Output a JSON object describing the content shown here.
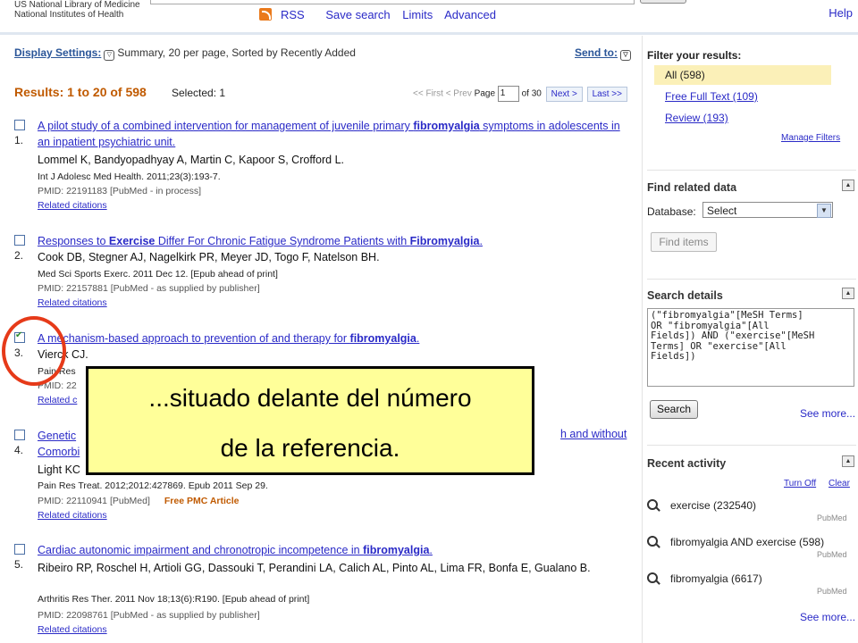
{
  "header": {
    "nlm_line1": "US National Library of Medicine",
    "nlm_line2": "National Institutes of Health",
    "toolbar": [
      "RSS",
      "Save search",
      "Limits",
      "Advanced"
    ],
    "help": "Help"
  },
  "display_settings": {
    "label": "Display Settings:",
    "value": "Summary, 20 per page, Sorted by Recently Added"
  },
  "send_to": "Send to:",
  "results": {
    "label": "Results: 1 to 20 of 598",
    "selected": "Selected: 1",
    "first": "<< First",
    "prev": "< Prev",
    "page_label": "Page",
    "page_value": "1",
    "of_pages": "of 30",
    "next": "Next >",
    "last": "Last >>"
  },
  "items": [
    {
      "num": "1.",
      "checked": false,
      "title_html": "A pilot study of a combined intervention for management of juvenile primary <b>fibromyalgia</b> symptoms in adolescents in an inpatient psychiatric unit.",
      "authors": "Lommel K, Bandyopadhyay A, Martin C, Kapoor S, Crofford L.",
      "journal": "Int J Adolesc Med Health. 2011;23(3):193-7.",
      "pmid": "PMID: 22191183 [PubMed - in process]",
      "related": "Related citations"
    },
    {
      "num": "2.",
      "checked": false,
      "title_html": "Responses to <b>Exercise</b> Differ For Chronic Fatigue Syndrome Patients with <b>Fibromyalgia</b>.",
      "authors": "Cook DB, Stegner AJ, Nagelkirk PR, Meyer JD, Togo F, Natelson BH.",
      "journal": "Med Sci Sports Exerc. 2011 Dec 12. [Epub ahead of print]",
      "pmid": "PMID: 22157881 [PubMed - as supplied by publisher]",
      "related": "Related citations"
    },
    {
      "num": "3.",
      "checked": true,
      "title_html": "A mechanism-based approach to prevention of and therapy for <b>fibromyalgia</b>.",
      "authors": "Vierck CJ.",
      "journal": "Pain Res",
      "pmid": "PMID: 22",
      "related": "Related c"
    },
    {
      "num": "4.",
      "checked": false,
      "title_html": "Genetic",
      "title2": "h and without",
      "title_line2": "Comorbi",
      "authors": "Light KC",
      "journal": "Pain Res Treat. 2012;2012:427869. Epub 2011 Sep 29.",
      "pmid": "PMID: 22110941 [PubMed]",
      "pmc": "Free PMC Article",
      "related": "Related citations"
    },
    {
      "num": "5.",
      "checked": false,
      "title_html": "Cardiac autonomic impairment and chronotropic incompetence in <b>fibromyalgia</b>.",
      "authors": "Ribeiro RP, Roschel H, Artioli GG, Dassouki T, Perandini LA, Calich AL, Pinto AL, Lima FR, Bonfa E, Gualano B.",
      "journal": "Arthritis Res Ther. 2011 Nov 18;13(6):R190. [Epub ahead of print]",
      "pmid": "PMID: 22098761 [PubMed - as supplied by publisher]",
      "related": "Related citations"
    }
  ],
  "sidebar": {
    "filter_heading": "Filter your results:",
    "filters": [
      "All (598)",
      "Free Full Text (109)",
      "Review (193)"
    ],
    "manage_filters": "Manage Filters",
    "find_related_heading": "Find related data",
    "database_label": "Database:",
    "database_value": "Select",
    "find_items": "Find items",
    "search_details_heading": "Search details",
    "search_details_text": "(\"fibromyalgia\"[MeSH Terms]\nOR \"fibromyalgia\"[All\nFields]) AND (\"exercise\"[MeSH\nTerms] OR \"exercise\"[All\nFields])",
    "search_button": "Search",
    "see_more": "See more...",
    "recent_heading": "Recent activity",
    "turn_off": "Turn Off",
    "clear": "Clear",
    "recent": [
      {
        "text": "exercise (232540)",
        "source": "PubMed"
      },
      {
        "text": "fibromyalgia AND exercise (598)",
        "source": "PubMed"
      },
      {
        "text": "fibromyalgia (6617)",
        "source": "PubMed"
      }
    ],
    "see_more_2": "See more..."
  },
  "callout": {
    "line1": "...situado delante del número",
    "line2": "de la referencia."
  },
  "colors": {
    "link": "#2a2ac7",
    "results_orange": "#c05a00",
    "callout_bg": "#ffff99",
    "highlight_circle": "#e63a19",
    "filter_selected_bg": "#fbf0b8"
  }
}
